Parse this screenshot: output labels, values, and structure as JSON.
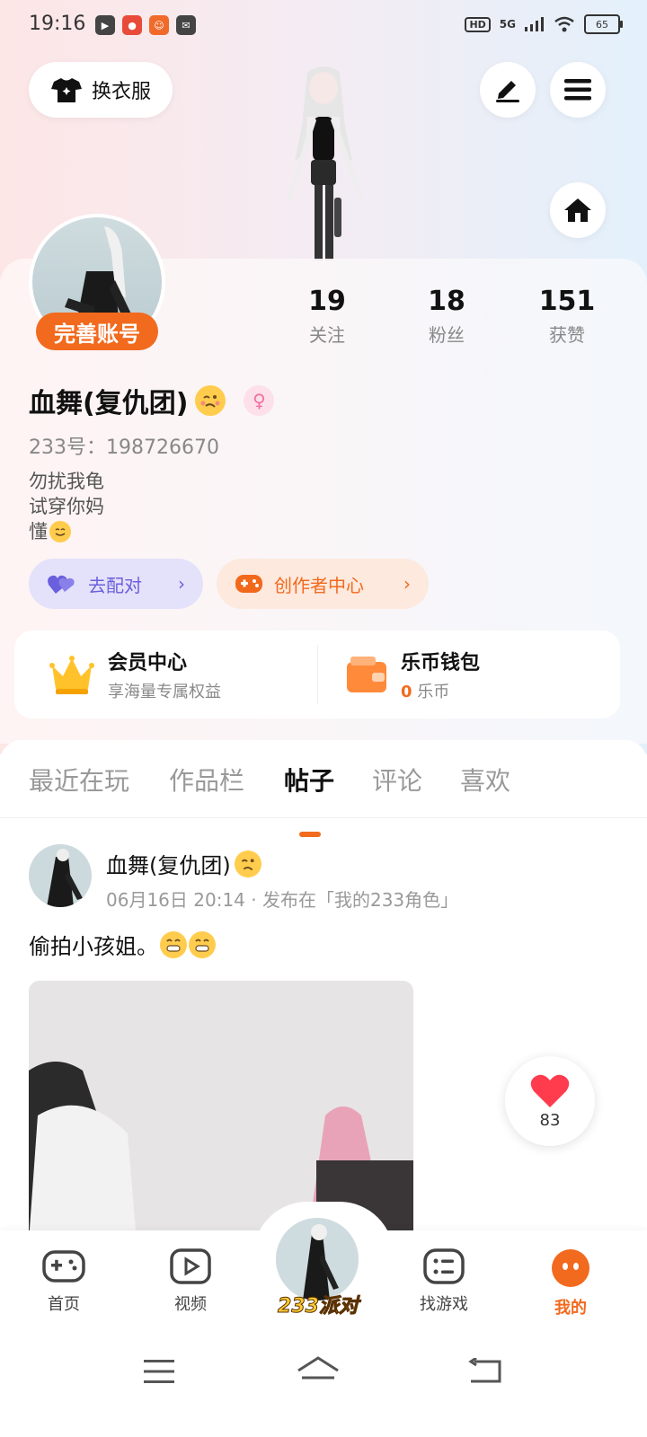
{
  "status_bar": {
    "time": "19:16",
    "network": "5G",
    "hd": "HD",
    "battery": "65"
  },
  "header": {
    "outfit_label": "换衣服"
  },
  "profile": {
    "complete_label": "完善账号",
    "stats": [
      {
        "num": "19",
        "label": "关注"
      },
      {
        "num": "18",
        "label": "粉丝"
      },
      {
        "num": "151",
        "label": "获赞"
      }
    ],
    "username": "血舞(复仇团)",
    "uid": "233号：198726670",
    "bio": [
      "勿扰我龟",
      "试穿你妈",
      "懂"
    ],
    "match_label": "去配对",
    "creator_label": "创作者中心"
  },
  "member": {
    "vip_title": "会员中心",
    "vip_sub": "享海量专属权益",
    "wallet_title": "乐币钱包",
    "wallet_amount": "0",
    "wallet_unit": "乐币"
  },
  "tabs": [
    "最近在玩",
    "作品栏",
    "帖子",
    "评论",
    "喜欢"
  ],
  "active_tab": "帖子",
  "post": {
    "author": "血舞(复仇团)",
    "meta": "06月16日 20:14 · 发布在「我的233角色」",
    "text": "偷拍小孩姐。",
    "likes": "83"
  },
  "bottom_nav": {
    "items": [
      "首页",
      "视频",
      "找游戏",
      "我的"
    ],
    "center_label": "233派对"
  },
  "colors": {
    "accent": "#f26a1e",
    "match": "#6a5fdc",
    "like": "#ff3b4e"
  }
}
